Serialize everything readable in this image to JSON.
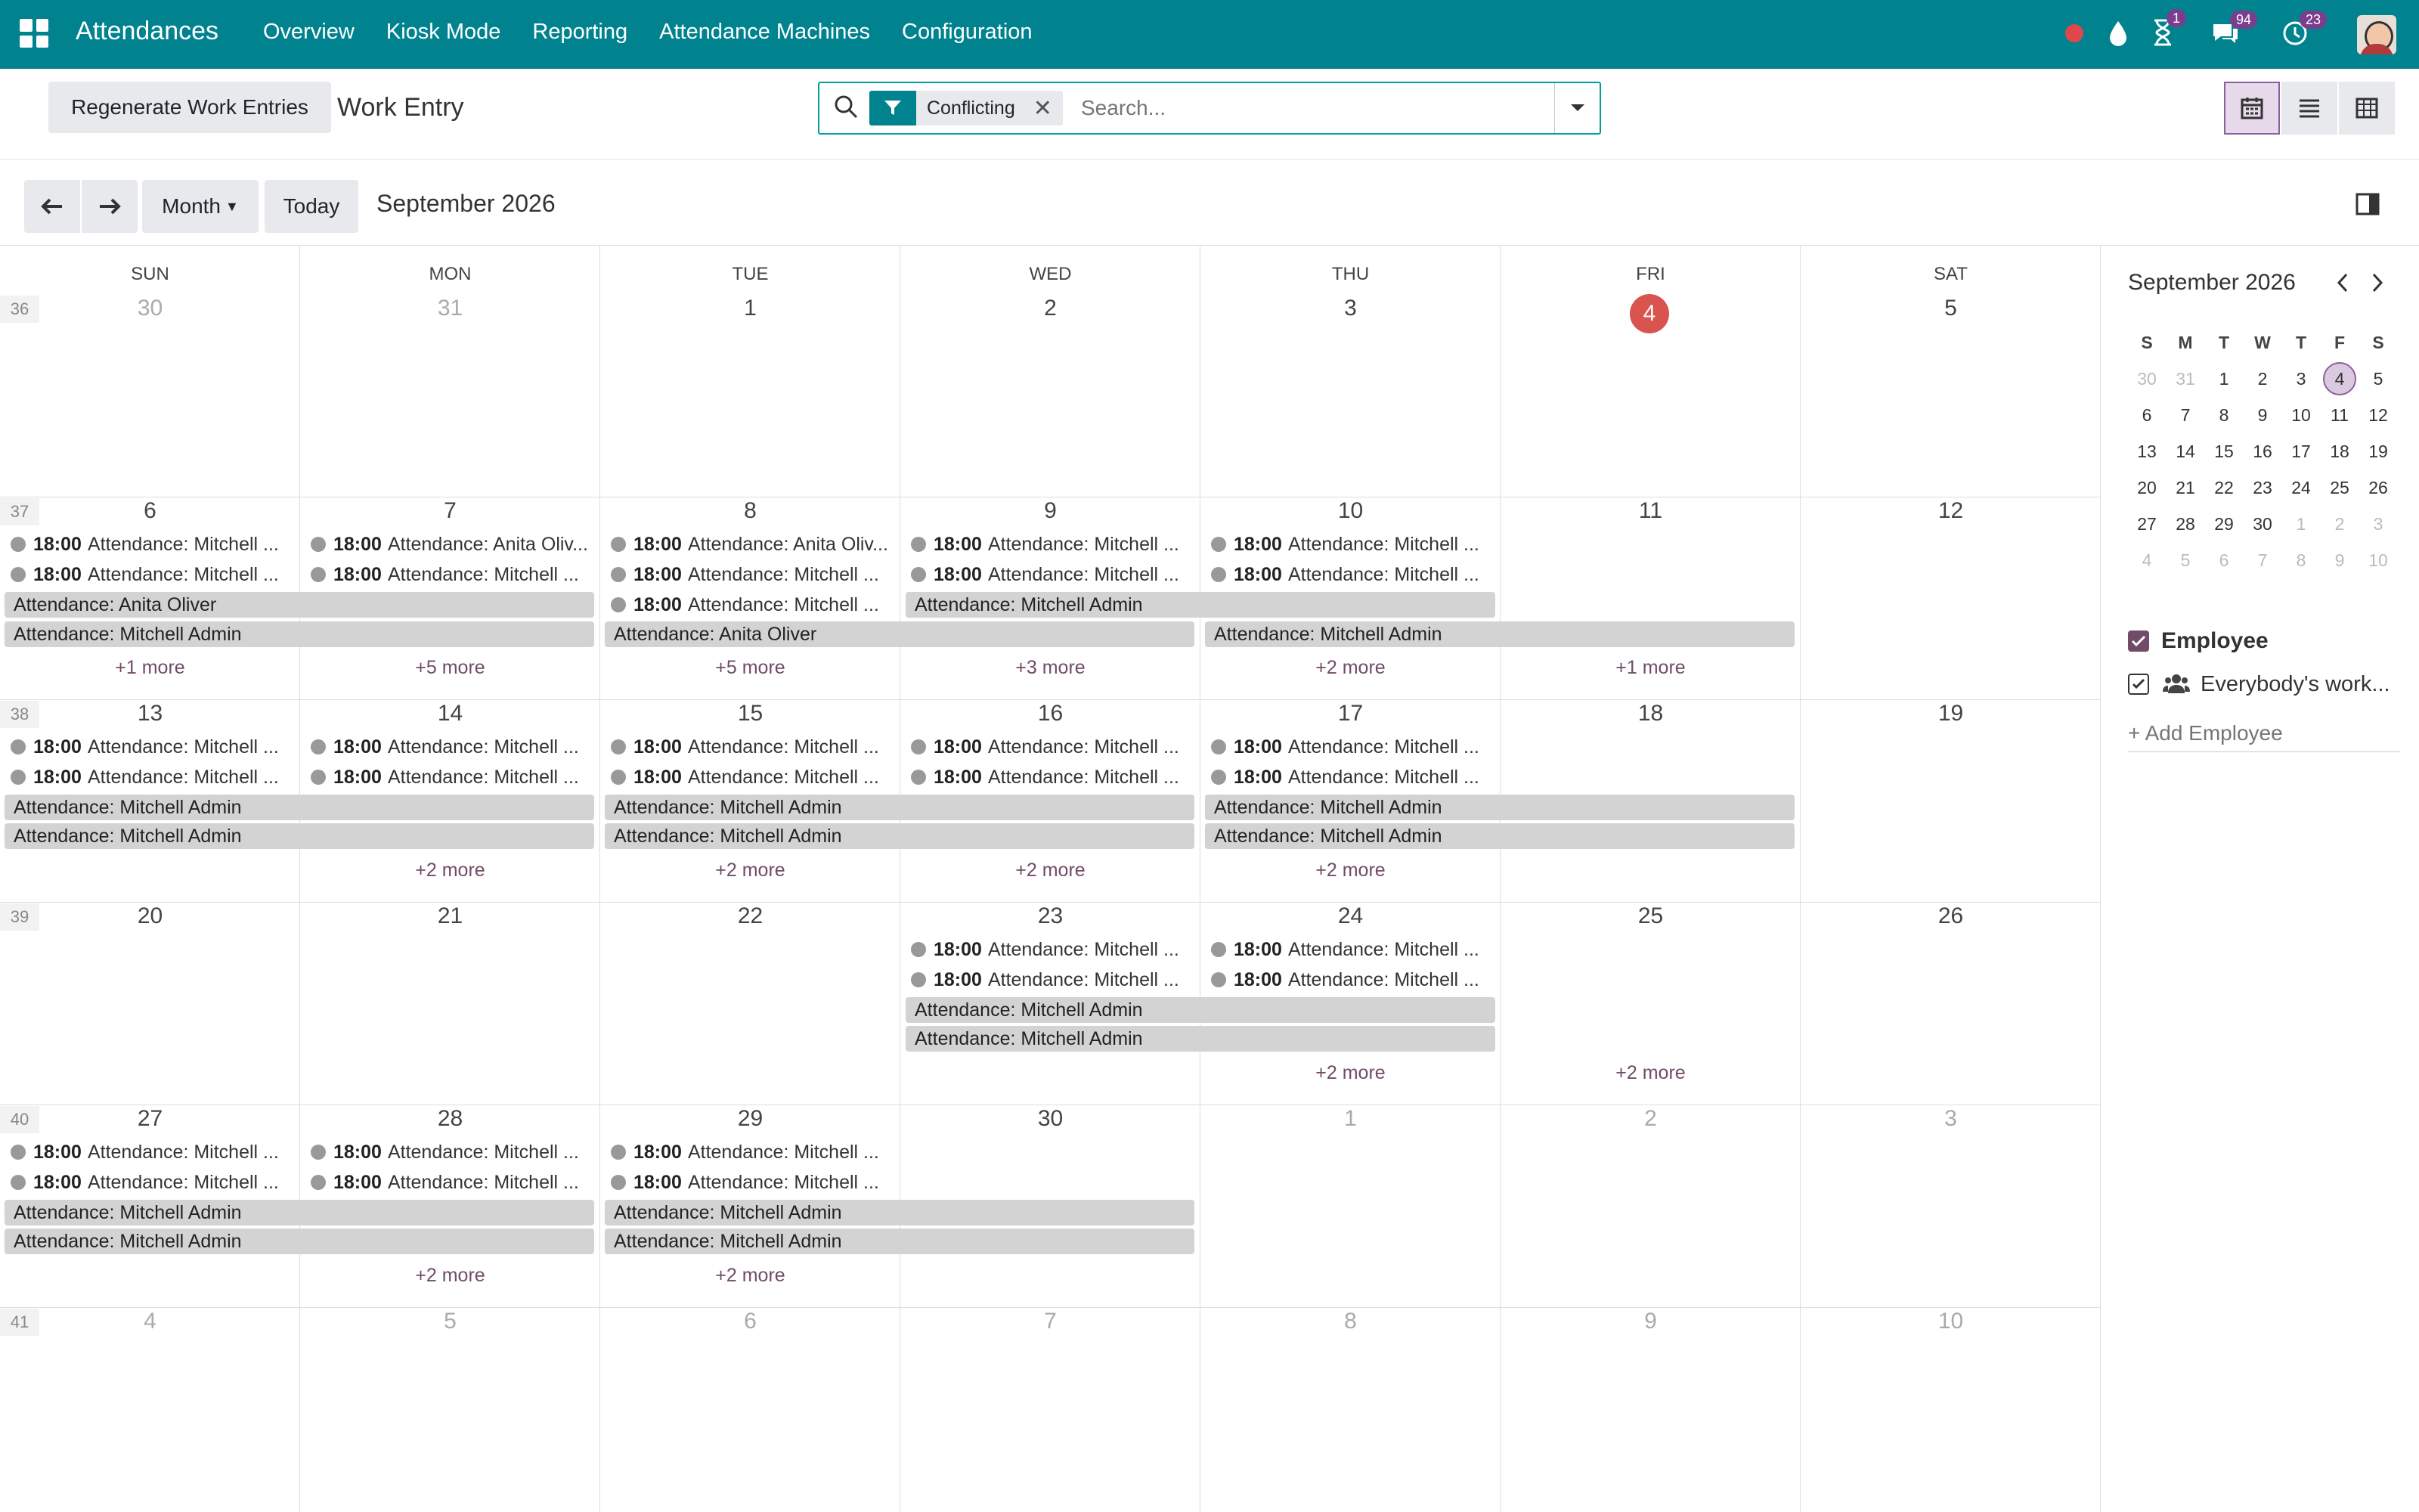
{
  "nav": {
    "app_title": "Attendances",
    "menu": [
      "Overview",
      "Kiosk Mode",
      "Reporting",
      "Attendance Machines",
      "Configuration"
    ],
    "badges": {
      "activities": "1",
      "messages": "94",
      "timer": "23"
    },
    "icons": [
      "apps-icon",
      "record-dot-icon",
      "drop-icon",
      "hourglass-icon",
      "chat-icon",
      "clock-icon",
      "avatar"
    ]
  },
  "control": {
    "regenerate_label": "Regenerate Work Entries",
    "breadcrumb": "Work Entry",
    "search": {
      "facet": "Conflicting",
      "placeholder": "Search..."
    }
  },
  "calendar_header": {
    "scale": "Month",
    "today": "Today",
    "period": "September 2026"
  },
  "calendar": {
    "weekdays": [
      "SUN",
      "MON",
      "TUE",
      "WED",
      "THU",
      "FRI",
      "SAT"
    ],
    "weeks": [
      {
        "num": "36",
        "days": [
          "30",
          "31",
          "1",
          "2",
          "3",
          "4",
          "5"
        ]
      },
      {
        "num": "37",
        "days": [
          "6",
          "7",
          "8",
          "9",
          "10",
          "11",
          "12"
        ]
      },
      {
        "num": "38",
        "days": [
          "13",
          "14",
          "15",
          "16",
          "17",
          "18",
          "19"
        ]
      },
      {
        "num": "39",
        "days": [
          "20",
          "21",
          "22",
          "23",
          "24",
          "25",
          "26"
        ]
      },
      {
        "num": "40",
        "days": [
          "27",
          "28",
          "29",
          "30",
          "1",
          "2",
          "3"
        ]
      },
      {
        "num": "41",
        "days": [
          "4",
          "5",
          "6",
          "7",
          "8",
          "9",
          "10"
        ]
      }
    ],
    "events": {
      "w1": [
        [
          "18:00",
          "Attendance: Mitchell ...",
          "Attendance: Mitchell ..."
        ],
        [
          "18:00",
          "Attendance: Anita Oliv...",
          "Attendance: Mitchell ..."
        ],
        [
          "18:00",
          "Attendance: Anita Oliv...",
          "Attendance: Mitchell ...",
          "Attendance: Mitchell ..."
        ],
        [
          "18:00",
          "Attendance: Mitchell ...",
          "Attendance: Mitchell ..."
        ],
        [
          "18:00",
          "Attendance: Mitchell ...",
          "Attendance: Mitchell ..."
        ]
      ],
      "bars": [
        "Attendance: Anita Oliver",
        "Attendance: Mitchell Admin",
        "Attendance: Anita Oliver"
      ],
      "more": {
        "w1": [
          "+1 more",
          "+5 more",
          "+5 more",
          "+3 more",
          "+2 more",
          "+1 more"
        ],
        "w2": [
          "+2 more",
          "+2 more",
          "+2 more",
          "+2 more"
        ],
        "w3": [
          "+2 more",
          "+2 more"
        ],
        "w4": [
          "+2 more",
          "+2 more"
        ]
      }
    }
  },
  "sidebar": {
    "mini_title": "September 2026",
    "mini_days": [
      "S",
      "M",
      "T",
      "W",
      "T",
      "F",
      "S"
    ],
    "mini_weeks": [
      [
        "30",
        "31",
        "1",
        "2",
        "3",
        "4",
        "5"
      ],
      [
        "6",
        "7",
        "8",
        "9",
        "10",
        "11",
        "12"
      ],
      [
        "13",
        "14",
        "15",
        "16",
        "17",
        "18",
        "19"
      ],
      [
        "20",
        "21",
        "22",
        "23",
        "24",
        "25",
        "26"
      ],
      [
        "27",
        "28",
        "29",
        "30",
        "1",
        "2",
        "3"
      ],
      [
        "4",
        "5",
        "6",
        "7",
        "8",
        "9",
        "10"
      ]
    ],
    "filter_title": "Employee",
    "filter_item": "Everybody's work...",
    "add_placeholder": "+ Add Employee"
  },
  "colors": {
    "navbar": "#00838f",
    "accent": "#714b67",
    "today": "#d9534f",
    "event": "#d3d3d3"
  }
}
